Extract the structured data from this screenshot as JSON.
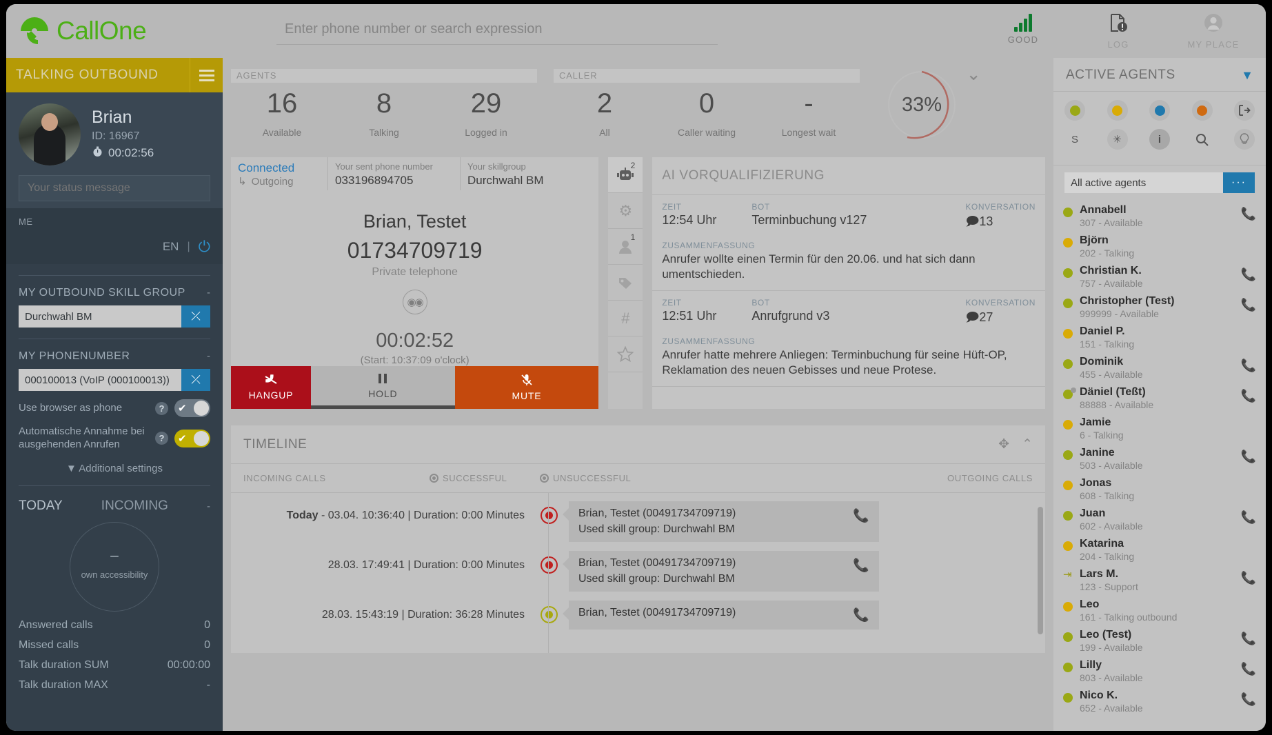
{
  "brand": {
    "name": "CallOne"
  },
  "header": {
    "search_placeholder": "Enter phone number or search expression",
    "search_value": "",
    "actions": [
      {
        "label": "GOOD",
        "icon": "signal-bars-icon"
      },
      {
        "label": "LOG",
        "icon": "log-document-icon"
      },
      {
        "label": "MY PLACE",
        "icon": "user-avatar-icon"
      }
    ]
  },
  "sidebar": {
    "status_title": "TALKING OUTBOUND",
    "profile": {
      "name": "Brian",
      "id": "ID: 16967",
      "timer": "00:02:56"
    },
    "status_message_placeholder": "Your status message",
    "status_message_value": "",
    "me_label": "ME",
    "language": "EN",
    "skillgroup": {
      "title": "MY OUTBOUND SKILL GROUP",
      "value": "Durchwahl BM",
      "meta": "-"
    },
    "phonenumber": {
      "title": "MY PHONENUMBER",
      "value": "000100013 (VoIP (000100013))",
      "meta": "-"
    },
    "toggles": [
      {
        "label": "Use browser as phone",
        "state": "off"
      },
      {
        "label": "Automatische Annahme bei ausgehenden Anrufen",
        "state": "on"
      }
    ],
    "additional_settings": "Additional settings",
    "today": {
      "a": "TODAY",
      "b": "INCOMING",
      "c": "-"
    },
    "gauge": {
      "value": "–",
      "caption": "own accessibility"
    },
    "stats": [
      {
        "label": "Answered calls",
        "value": "0"
      },
      {
        "label": "Missed calls",
        "value": "0"
      },
      {
        "label": "Talk duration SUM",
        "value": "00:00:00"
      },
      {
        "label": "Talk duration MAX",
        "value": "-"
      }
    ]
  },
  "kpis": {
    "agents_title": "AGENTS",
    "caller_title": "CALLER",
    "agents": [
      {
        "num": "16",
        "cap": "Available"
      },
      {
        "num": "8",
        "cap": "Talking"
      },
      {
        "num": "29",
        "cap": "Logged in"
      }
    ],
    "caller": [
      {
        "num": "2",
        "cap": "All"
      },
      {
        "num": "0",
        "cap": "Caller waiting"
      },
      {
        "num": "-",
        "cap": "Longest wait"
      }
    ],
    "donut_pct": "33%"
  },
  "call": {
    "state": "Connected",
    "direction": "Outgoing",
    "sent_number_label": "Your sent phone number",
    "sent_number_value": "033196894705",
    "skillgroup_label": "Your skillgroup",
    "skillgroup_value": "Durchwahl BM",
    "contact_name": "Brian, Testet",
    "contact_number": "01734709719",
    "number_type": "Private telephone",
    "duration": "00:02:52",
    "start": "(Start: 10:37:09 o'clock)",
    "actions": [
      {
        "label": "HANGUP",
        "icon": "hangup-icon"
      },
      {
        "label": "HOLD",
        "icon": "pause-icon"
      },
      {
        "label": "MUTE",
        "icon": "mic-muted-icon"
      }
    ],
    "strip": [
      {
        "icon": "robot-icon",
        "badge": "2"
      },
      {
        "icon": "gear-icon",
        "badge": ""
      },
      {
        "icon": "person-icon",
        "badge": "1"
      },
      {
        "icon": "tag-icon",
        "badge": ""
      },
      {
        "icon": "hash-icon",
        "badge": ""
      },
      {
        "icon": "star-icon",
        "badge": ""
      }
    ]
  },
  "ai": {
    "title": "AI VORQUALIFIZIERUNG",
    "keys": {
      "zeit": "ZEIT",
      "bot": "BOT",
      "konversation": "KONVERSATION",
      "zusammenfassung": "ZUSAMMENFASSUNG"
    },
    "entries": [
      {
        "zeit": "12:54 Uhr",
        "bot": "Terminbuchung v127",
        "konversation": "13",
        "zusammenfassung": "Anrufer wollte einen Termin für den 20.06. und hat sich dann umentschieden."
      },
      {
        "zeit": "12:51 Uhr",
        "bot": "Anrufgrund v3",
        "konversation": "27",
        "zusammenfassung": "Anrufer hatte mehrere Anliegen: Terminbuchung für seine Hüft-OP, Reklamation des neuen Gebisses und neue Protese."
      }
    ]
  },
  "timeline": {
    "title": "TIMELINE",
    "legend": {
      "incoming": "INCOMING CALLS",
      "successful": "SUCCESSFUL",
      "unsuccessful": "UNSUCCESSFUL",
      "outgoing": "OUTGOING CALLS"
    },
    "rows": [
      {
        "prefix": "Today",
        "time": " - 03.04. 10:36:40 | Duration: 0:00 Minutes",
        "status": "red",
        "line1": "Brian, Testet (00491734709719)",
        "line2": "Used skill group: Durchwahl BM"
      },
      {
        "prefix": "",
        "time": "28.03. 17:49:41 | Duration: 0:00 Minutes",
        "status": "red",
        "line1": "Brian, Testet (00491734709719)",
        "line2": "Used skill group: Durchwahl BM"
      },
      {
        "prefix": "",
        "time": "28.03. 15:43:19 | Duration: 36:28 Minutes",
        "status": "olive",
        "line1": "Brian, Testet (00491734709719)",
        "line2": ""
      }
    ]
  },
  "agents_panel": {
    "title": "ACTIVE AGENTS",
    "filter_icon": "filter-triangle-icon",
    "quickfilters_row1": [
      {
        "icon": "status-dot-olive",
        "color": "#9aa815"
      },
      {
        "icon": "status-dot-yellow",
        "color": "#d9ab06"
      },
      {
        "icon": "status-dot-blue",
        "color": "#2079ad"
      },
      {
        "icon": "status-dot-orange",
        "color": "#cf6a11"
      },
      {
        "icon": "logout-arrow-icon",
        "color": ""
      }
    ],
    "quickfilters_row2": [
      {
        "icon": "letter-s-icon",
        "label": "S"
      },
      {
        "icon": "asterisk-icon",
        "label": "✳"
      },
      {
        "icon": "info-icon",
        "label": "i"
      },
      {
        "icon": "search-icon",
        "label": "search"
      },
      {
        "icon": "lightbulb-icon",
        "label": "bulb"
      }
    ],
    "search_value": "All active agents",
    "more_label": "···",
    "agents": [
      {
        "name": "Annabell",
        "detail": "307 - Available",
        "color": "#9aa815",
        "phone": true
      },
      {
        "name": "Björn",
        "detail": "202 - Talking",
        "color": "#d9ab06",
        "phone": false
      },
      {
        "name": "Christian K.",
        "detail": "757 - Available",
        "color": "#9aa815",
        "phone": true
      },
      {
        "name": "Christopher (Test)",
        "detail": "999999 - Available",
        "color": "#9aa815",
        "phone": true
      },
      {
        "name": "Daniel P.",
        "detail": "151 - Talking",
        "color": "#d9ab06",
        "phone": false
      },
      {
        "name": "Dominik",
        "detail": "455 - Available",
        "color": "#9aa815",
        "phone": true
      },
      {
        "name": "Däniel (Teßt)",
        "detail": "88888 - Available",
        "color": "#9aa815",
        "phone": true,
        "sub": true
      },
      {
        "name": "Jamie",
        "detail": "6 - Talking",
        "color": "#d9ab06",
        "phone": false
      },
      {
        "name": "Janine",
        "detail": "503 - Available",
        "color": "#9aa815",
        "phone": true
      },
      {
        "name": "Jonas",
        "detail": "608 - Talking",
        "color": "#d9ab06",
        "phone": false
      },
      {
        "name": "Juan",
        "detail": "602 - Available",
        "color": "#9aa815",
        "phone": true
      },
      {
        "name": "Katarina",
        "detail": "204 - Talking",
        "color": "#d9ab06",
        "phone": false
      },
      {
        "name": "Lars M.",
        "detail": "123 - Support",
        "color": "",
        "phone": true,
        "icon": "logout-arrow-icon"
      },
      {
        "name": "Leo",
        "detail": "161 - Talking outbound",
        "color": "#d9ab06",
        "phone": false
      },
      {
        "name": "Leo (Test)",
        "detail": "199 - Available",
        "color": "#9aa815",
        "phone": true
      },
      {
        "name": "Lilly",
        "detail": "803 - Available",
        "color": "#9aa815",
        "phone": true
      },
      {
        "name": "Nico K.",
        "detail": "652 - Available",
        "color": "#9aa815",
        "phone": true
      }
    ]
  }
}
